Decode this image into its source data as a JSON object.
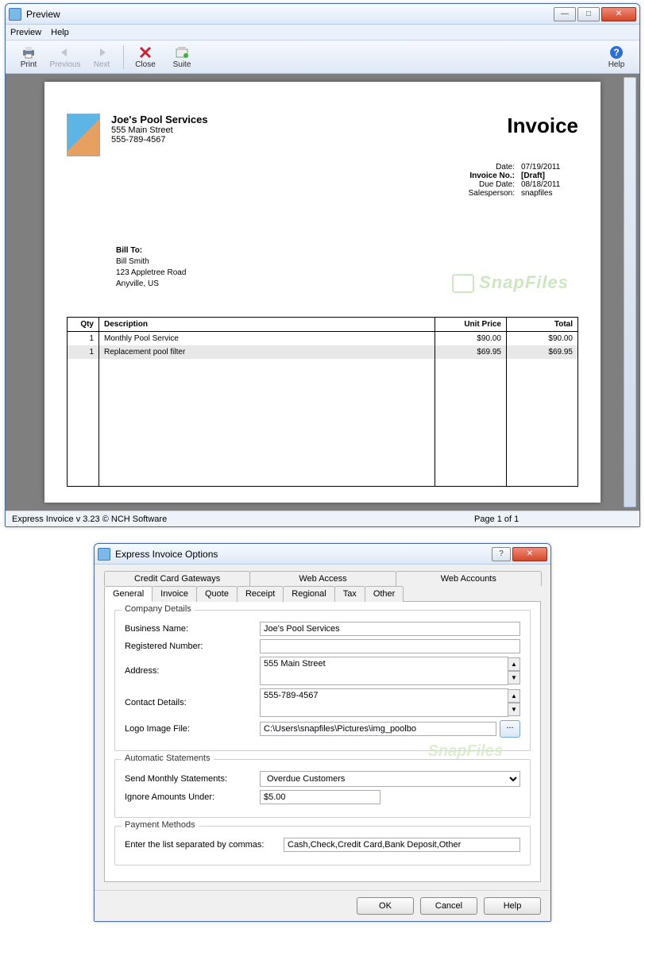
{
  "preview": {
    "title": "Preview",
    "menu": {
      "preview": "Preview",
      "help": "Help"
    },
    "toolbar": {
      "print": "Print",
      "previous": "Previous",
      "next": "Next",
      "close": "Close",
      "suite": "Suite",
      "help": "Help"
    },
    "status_left": "Express Invoice v 3.23 © NCH Software",
    "status_page": "Page 1 of 1"
  },
  "invoice": {
    "company_name": "Joe's Pool Services",
    "company_addr": "555 Main Street",
    "company_phone": "555-789-4567",
    "doc_title": "Invoice",
    "meta": {
      "date_lbl": "Date:",
      "date": "07/19/2011",
      "num_lbl": "Invoice No.:",
      "num": "[Draft]",
      "due_lbl": "Due Date:",
      "due": "08/18/2011",
      "sales_lbl": "Salesperson:",
      "sales": "snapfiles"
    },
    "billto": {
      "h": "Bill To:",
      "name": "Bill Smith",
      "addr": "123 Appletree Road",
      "city": "Anyville, US"
    },
    "watermark": "SnapFiles",
    "cols": {
      "qty": "Qty",
      "desc": "Description",
      "up": "Unit Price",
      "tot": "Total"
    },
    "rows": [
      {
        "qty": "1",
        "desc": "Monthly Pool Service",
        "up": "$90.00",
        "tot": "$90.00"
      },
      {
        "qty": "1",
        "desc": "Replacement pool filter",
        "up": "$69.95",
        "tot": "$69.95"
      }
    ]
  },
  "options": {
    "title": "Express Invoice Options",
    "tabs_top": [
      "Credit Card Gateways",
      "Web Access",
      "Web Accounts"
    ],
    "tabs_bot": [
      "General",
      "Invoice",
      "Quote",
      "Receipt",
      "Regional",
      "Tax",
      "Other"
    ],
    "company": {
      "group": "Company Details",
      "business_lbl": "Business Name:",
      "business": "Joe's Pool Services",
      "regnum_lbl": "Registered Number:",
      "regnum": "",
      "address_lbl": "Address:",
      "address": "555 Main Street",
      "contact_lbl": "Contact Details:",
      "contact": "555-789-4567",
      "logo_lbl": "Logo Image File:",
      "logo": "C:\\Users\\snapfiles\\Pictures\\img_poolbo",
      "browse": "..."
    },
    "auto": {
      "group": "Automatic Statements",
      "send_lbl": "Send Monthly Statements:",
      "send": "Overdue Customers",
      "ignore_lbl": "Ignore Amounts Under:",
      "ignore": "$5.00"
    },
    "pay": {
      "group": "Payment Methods",
      "list_lbl": "Enter the list separated by commas:",
      "list": "Cash,Check,Credit Card,Bank Deposit,Other"
    },
    "buttons": {
      "ok": "OK",
      "cancel": "Cancel",
      "help": "Help"
    }
  }
}
